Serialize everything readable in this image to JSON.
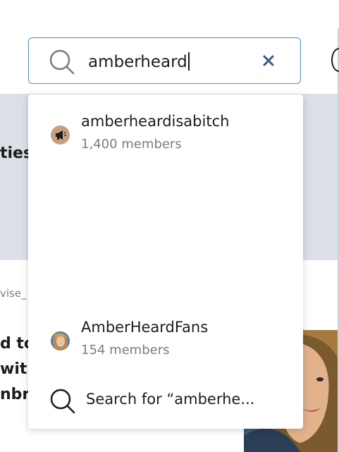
{
  "search": {
    "value": "amberheard",
    "icon": "search-icon",
    "clear_icon": "close-icon",
    "accent_color": "#4a8ec2"
  },
  "background": {
    "text_ties": "ties",
    "meta_text": "vise_",
    "title_lines": [
      "d to",
      "with",
      "nbr"
    ]
  },
  "results": [
    {
      "name": "amberheardisabitch",
      "members": "1,400 members",
      "icon": "megaphone-icon",
      "avatar_color": "#c9a07e"
    },
    {
      "name": "AmberHeardFans",
      "members": "154 members",
      "icon": "avatar-photo",
      "avatar_color": "#b08a5c"
    }
  ],
  "search_for": {
    "label": "Search for “amberhe...",
    "icon": "search-icon"
  }
}
